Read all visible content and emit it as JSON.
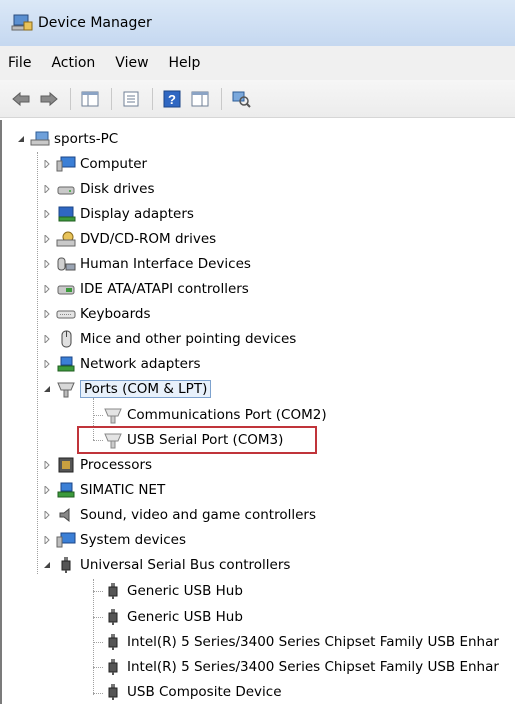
{
  "window": {
    "title": "Device Manager"
  },
  "menu": [
    "File",
    "Action",
    "View",
    "Help"
  ],
  "toolbar": {
    "buttons": [
      "back-icon",
      "forward-icon",
      "show-hide-console-tree-icon",
      "properties-icon",
      "help-icon",
      "action-pane-icon",
      "scan-hardware-icon"
    ]
  },
  "tree": {
    "root": "sports-PC",
    "categories": [
      {
        "label": "Computer",
        "icon": "computer-icon"
      },
      {
        "label": "Disk drives",
        "icon": "disk-drive-icon"
      },
      {
        "label": "Display adapters",
        "icon": "display-adapter-icon"
      },
      {
        "label": "DVD/CD-ROM drives",
        "icon": "dvd-drive-icon"
      },
      {
        "label": "Human Interface Devices",
        "icon": "hid-icon"
      },
      {
        "label": "IDE ATA/ATAPI controllers",
        "icon": "ide-controller-icon"
      },
      {
        "label": "Keyboards",
        "icon": "keyboard-icon"
      },
      {
        "label": "Mice and other pointing devices",
        "icon": "mouse-icon"
      },
      {
        "label": "Network adapters",
        "icon": "network-adapter-icon"
      },
      {
        "label": "Ports (COM & LPT)",
        "icon": "port-icon"
      },
      {
        "label": "Processors",
        "icon": "processor-icon"
      },
      {
        "label": "SIMATIC NET",
        "icon": "network-icon"
      },
      {
        "label": "Sound, video and game controllers",
        "icon": "speaker-icon"
      },
      {
        "label": "System devices",
        "icon": "computer-icon"
      },
      {
        "label": "Universal Serial Bus controllers",
        "icon": "usb-icon"
      }
    ],
    "ports_children": [
      "Communications Port (COM2)",
      "USB Serial Port (COM3)"
    ],
    "usb_children": [
      "Generic USB Hub",
      "Generic USB Hub",
      "Intel(R) 5 Series/3400 Series Chipset Family USB Enhar",
      "Intel(R) 5 Series/3400 Series Chipset Family USB Enhar",
      "USB Composite Device"
    ]
  },
  "colors": {
    "highlight_border": "#c0343a",
    "focus_border": "#7da2ce"
  }
}
